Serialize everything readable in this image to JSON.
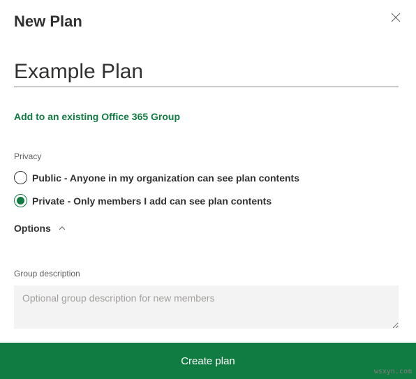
{
  "header": {
    "title": "New Plan"
  },
  "planName": {
    "value": "Example Plan"
  },
  "addToGroup": {
    "label": "Add to an existing Office 365 Group"
  },
  "privacy": {
    "label": "Privacy",
    "options": {
      "public": {
        "label": "Public - Anyone in my organization can see plan contents",
        "selected": false
      },
      "private": {
        "label": "Private - Only members I add can see plan contents",
        "selected": true
      }
    }
  },
  "optionsToggle": {
    "label": "Options",
    "expanded": true
  },
  "groupDescription": {
    "label": "Group description",
    "placeholder": "Optional group description for new members",
    "value": ""
  },
  "createButton": {
    "label": "Create plan"
  },
  "watermark": "wsxyn.com",
  "colors": {
    "accent": "#107c41"
  }
}
